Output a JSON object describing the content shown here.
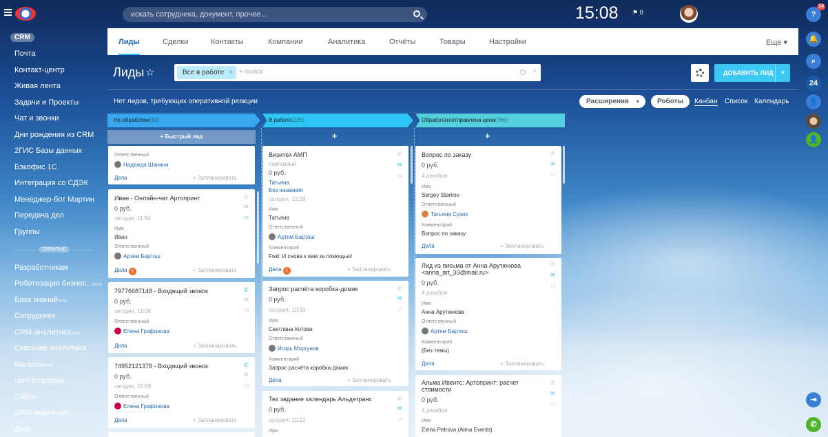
{
  "topbar": {
    "search_placeholder": "искать сотрудника, документ, прочее...",
    "time": "15:08",
    "flag_count": "0"
  },
  "rightbar": {
    "help_badge": "14",
    "counter": "24"
  },
  "leftnav": {
    "section": "CRM",
    "items": [
      "Почта",
      "Контакт-центр",
      "Живая лента",
      "Задачи и Проекты",
      "Чат и звонки",
      "Дни рождения из CRM",
      "2ГИС Базы данных",
      "Бэкофис 1С",
      "Интеграция со СДЭК",
      "Менеджер-бот Мартин",
      "Передача дел",
      "Группы"
    ],
    "hidden_label": "СКРЫТЫЕ",
    "hidden_items": [
      "Разработчикам",
      "Роботизация бизнес...",
      "База знаний",
      "Сотрудники",
      "CRM-аналитика",
      "Сквозная аналитика",
      "Магазин",
      "Центр продаж",
      "Сайты",
      "CRM-маркетинг",
      "Диск"
    ],
    "beta": "beta"
  },
  "tabs": [
    "Лиды",
    "Сделки",
    "Контакты",
    "Компании",
    "Аналитика",
    "Отчёты",
    "Товары",
    "Настройки"
  ],
  "tabs_more": "Еще",
  "page": {
    "title": "Лиды",
    "filter_chip": "Все в работе",
    "filter_placeholder": "+ поиск",
    "add_button": "ДОБАВИТЬ ЛИД"
  },
  "notice": "Нет лидов, требующих оперативной реакции",
  "toolbar": {
    "extensions": "Расширения",
    "robots": "Роботы",
    "views": [
      "Канбан",
      "Список",
      "Календарь"
    ]
  },
  "columns": [
    {
      "title": "Не обработан",
      "count": "(50)",
      "color": "#39a8ef"
    },
    {
      "title": "В работе",
      "count": "(226)",
      "color": "#2fc6f6"
    },
    {
      "title": "Обработан/отправлена цена",
      "count": "(786)",
      "color": "#55d0e0"
    }
  ],
  "quick_lead": "Быстрый лид",
  "plus": "+",
  "labels": {
    "responsible": "Ответственный",
    "name": "Имя",
    "comment": "Комментарий",
    "deals": "Дела",
    "plan": "+ Запланировать"
  },
  "cards": {
    "c1": {
      "responsible": "Надежда Шанина"
    },
    "c2": {
      "title": "Иван - Онлайн-чат Артопринт",
      "price": "0 руб.",
      "date": "сегодня, 11:54",
      "name": "Иван",
      "responsible": "Артем Бартош",
      "badge": "1"
    },
    "c3": {
      "title": "79776687148 - Входящий звонок",
      "price": "0 руб.",
      "date": "сегодня, 11:09",
      "responsible": "Елена Графонова"
    },
    "c4": {
      "title": "74952121378 - Входящий звонок",
      "price": "0 руб.",
      "date": "сегодня, 10:59",
      "responsible": "Елена Графонова"
    },
    "c5": {
      "title": "Визитки АМП",
      "sub": "повторный",
      "price": "0 руб.",
      "link1": "Татьяна",
      "link2": "Без названия",
      "date": "сегодня, 13:28",
      "name": "Татьяна",
      "responsible": "Артем Бартош",
      "comment": "Fwd: И снова к вам за помощью!",
      "badge": "1"
    },
    "c6": {
      "title": "Запрос расчёта коробка-домик",
      "price": "0 руб.",
      "date": "сегодня, 10:33",
      "name": "Светлана Котова",
      "responsible": "Игорь Моргунов",
      "comment": "Запрос расчёта коробка-домик"
    },
    "c7": {
      "title": "Тех задание календарь Альдетранс",
      "price": "0 руб.",
      "date": "сегодня, 10:22"
    },
    "c8": {
      "title": "Вопрос по заказу",
      "price": "0 руб.",
      "date": "4 декабря",
      "name": "Sergey Starkov",
      "responsible": "Татьяна Сухих",
      "comment": "Вопрос по заказу"
    },
    "c9": {
      "title1": "Лид из письма от Анна Арутюнова",
      "title2": "<anna_art_33@mail.ru>",
      "price": "0 руб.",
      "date": "4 декабря",
      "name": "Анна Арутюнова",
      "responsible": "Артем Бартош",
      "comment": "(Без темы)"
    },
    "c10": {
      "title1": "Альма Ивентс: Артопринт: расчет",
      "title2": "стоимости",
      "price": "0 руб.",
      "date": "4 декабря",
      "name": "Elena Petrova (Alma Events)"
    }
  },
  "colors": {
    "accent": "#2fc6f6",
    "add_button": "#3bc8f5",
    "badge": "#f26b2e"
  }
}
